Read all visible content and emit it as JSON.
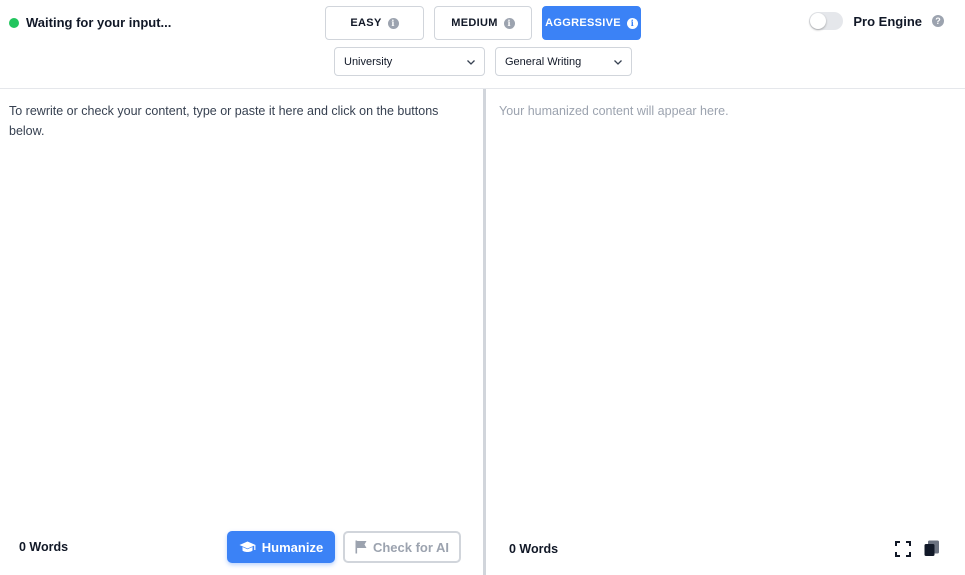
{
  "status": {
    "text": "Waiting for your input...",
    "color": "#22c55e"
  },
  "modes": [
    {
      "label": "EASY",
      "active": false,
      "icon": "info-icon"
    },
    {
      "label": "MEDIUM",
      "active": false,
      "icon": "info-icon"
    },
    {
      "label": "AGGRESSIVE",
      "active": true,
      "icon": "info-icon"
    }
  ],
  "selects": {
    "level": {
      "value": "University",
      "icon": "chevron-down-icon"
    },
    "purpose": {
      "value": "General Writing",
      "icon": "chevron-down-icon"
    }
  },
  "pro_engine": {
    "label": "Pro Engine",
    "enabled": false,
    "help_glyph": "?"
  },
  "input_pane": {
    "placeholder": "To rewrite or check your content, type or paste it here and click on the buttons below.",
    "word_count": "0 Words"
  },
  "output_pane": {
    "placeholder": "Your humanized content will appear here.",
    "word_count": "0 Words"
  },
  "actions": {
    "humanize_label": "Humanize",
    "check_label": "Check for AI"
  },
  "colors": {
    "accent": "#3b82f6",
    "muted": "#9ca3af"
  }
}
